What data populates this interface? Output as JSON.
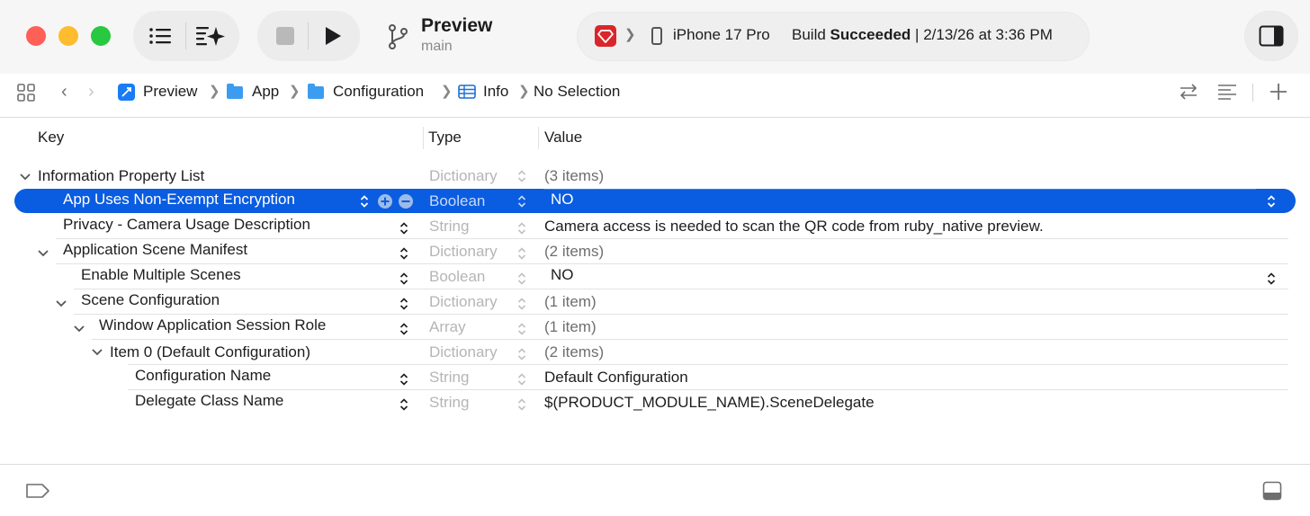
{
  "window": {
    "scheme_title": "Preview",
    "branch": "main",
    "device": "iPhone 17 Pro",
    "build_status_prefix": "Build",
    "build_status": "Succeeded",
    "build_time": "2/13/26 at 3:36 PM",
    "colors": {
      "selection": "#0a5ce0",
      "close": "#fe5f57",
      "minimize": "#febc2e",
      "zoom": "#28c840",
      "ruby": "#d9262b"
    }
  },
  "breadcrumb": {
    "items": [
      "Preview",
      "App",
      "Configuration",
      "Info",
      "No Selection"
    ]
  },
  "columns": {
    "key": "Key",
    "type": "Type",
    "value": "Value"
  },
  "rows": [
    {
      "key": "Information Property List",
      "type": "Dictionary",
      "value": "(3 items)"
    },
    {
      "key": "App Uses Non-Exempt Encryption",
      "type": "Boolean",
      "value": "NO"
    },
    {
      "key": "Privacy - Camera Usage Description",
      "type": "String",
      "value": "Camera access is needed to scan the QR code from ruby_native preview."
    },
    {
      "key": "Application Scene Manifest",
      "type": "Dictionary",
      "value": "(2 items)"
    },
    {
      "key": "Enable Multiple Scenes",
      "type": "Boolean",
      "value": "NO"
    },
    {
      "key": "Scene Configuration",
      "type": "Dictionary",
      "value": "(1 item)"
    },
    {
      "key": "Window Application Session Role",
      "type": "Array",
      "value": "(1 item)"
    },
    {
      "key": "Item 0 (Default Configuration)",
      "type": "Dictionary",
      "value": "(2 items)"
    },
    {
      "key": "Configuration Name",
      "type": "String",
      "value": "Default Configuration"
    },
    {
      "key": "Delegate Class Name",
      "type": "String",
      "value": "$(PRODUCT_MODULE_NAME).SceneDelegate"
    }
  ]
}
